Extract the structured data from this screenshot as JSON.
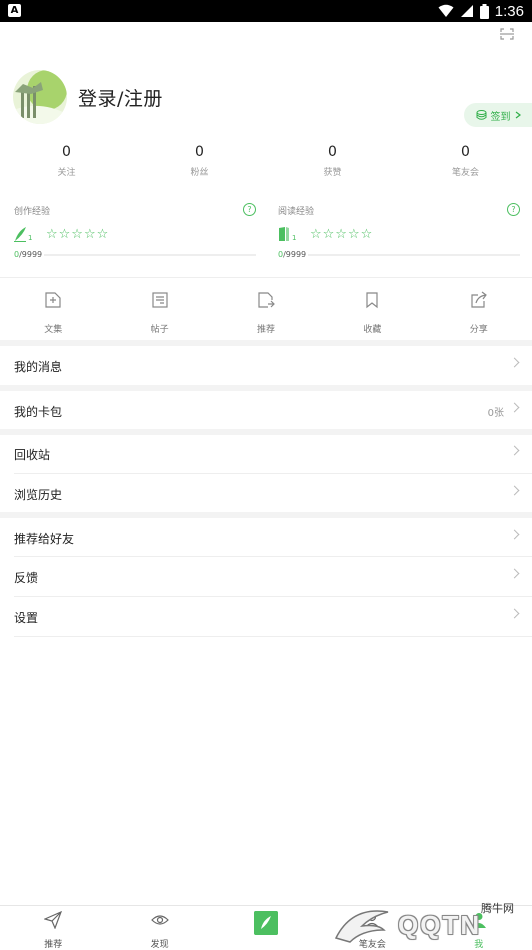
{
  "status_bar": {
    "app_badge": "A",
    "time": "1:36"
  },
  "profile": {
    "login_label": "登录/注册",
    "signin_label": "签到"
  },
  "stats": [
    {
      "value": "0",
      "label": "关注"
    },
    {
      "value": "0",
      "label": "粉丝"
    },
    {
      "value": "0",
      "label": "获赞"
    },
    {
      "value": "0",
      "label": "笔友会"
    }
  ],
  "experience": {
    "writing": {
      "title": "创作经验",
      "level": "1",
      "stars": "☆☆☆☆☆",
      "current": "0",
      "max": "/9999"
    },
    "reading": {
      "title": "阅读经验",
      "level": "1",
      "stars": "☆☆☆☆☆",
      "current": "0",
      "max": "/9999"
    }
  },
  "tools": [
    {
      "label": "文集",
      "icon": "add-file-icon"
    },
    {
      "label": "帖子",
      "icon": "post-icon"
    },
    {
      "label": "推荐",
      "icon": "recommend-icon"
    },
    {
      "label": "收藏",
      "icon": "bookmark-icon"
    },
    {
      "label": "分享",
      "icon": "share-icon"
    }
  ],
  "menu": {
    "messages": "我的消息",
    "card_pack": "我的卡包",
    "card_count": "0张",
    "recycle": "回收站",
    "history": "浏览历史",
    "recommend_friends": "推荐给好友",
    "feedback": "反馈",
    "settings": "设置"
  },
  "tabbar": [
    {
      "label": "推荐",
      "icon": "send-icon"
    },
    {
      "label": "发现",
      "icon": "eye-icon"
    },
    {
      "label": "",
      "icon": "feather-write-icon"
    },
    {
      "label": "笔友会",
      "icon": "group-icon"
    },
    {
      "label": "我",
      "icon": "person-icon"
    }
  ],
  "watermark": {
    "text": "QQTN",
    "site": "腾牛网"
  },
  "colors": {
    "accent": "#4cbf60",
    "signin_bg": "#e8f6ea"
  }
}
